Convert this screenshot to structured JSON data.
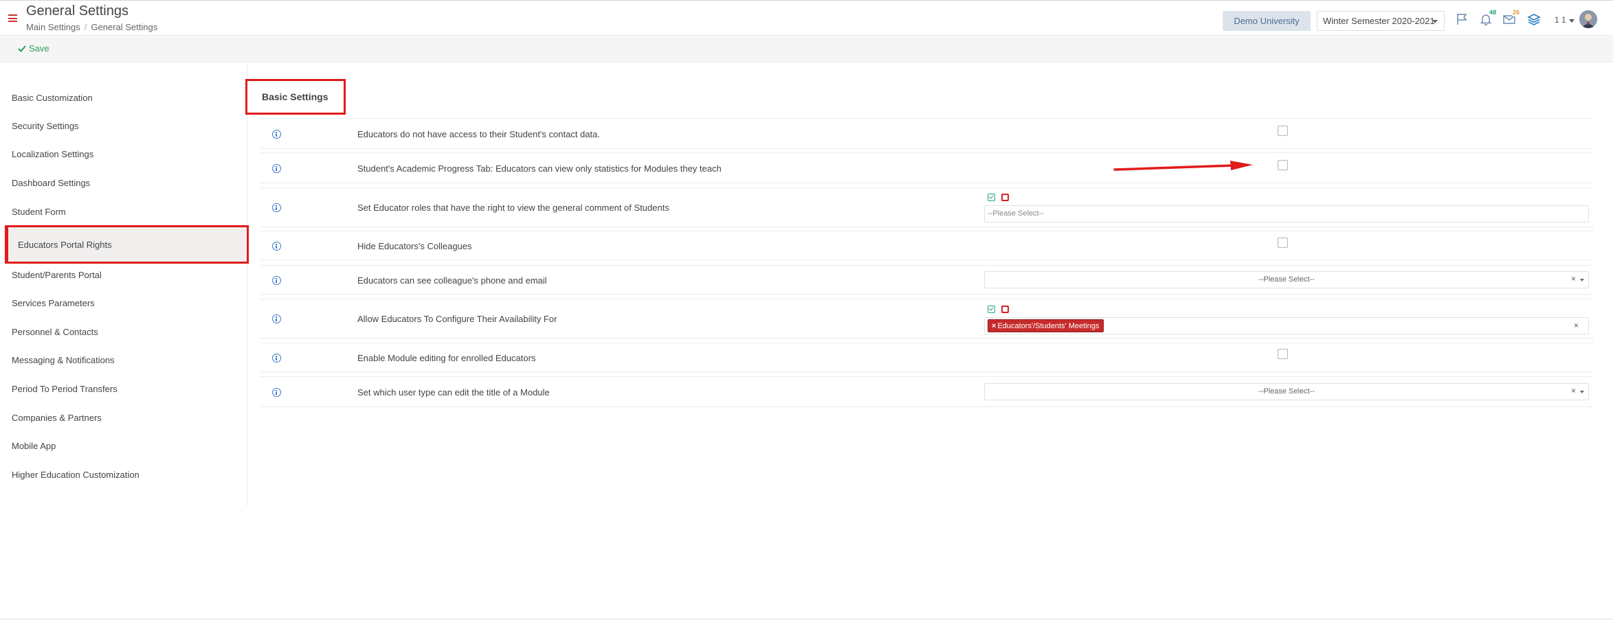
{
  "header": {
    "title": "General Settings",
    "breadcrumb": [
      "Main Settings",
      "General Settings"
    ],
    "university": "Demo University",
    "semester": "Winter Semester 2020-2021",
    "notifications_badge": "48",
    "messages_badge": "26",
    "user_count": "1 1"
  },
  "toolbar": {
    "save_label": "Save"
  },
  "sidebar": {
    "items": [
      "Basic Customization",
      "Security Settings",
      "Localization Settings",
      "Dashboard Settings",
      "Student Form",
      "Educators Portal Rights",
      "Student/Parents Portal",
      "Services Parameters",
      "Personnel & Contacts",
      "Messaging & Notifications",
      "Period To Period Transfers",
      "Companies & Partners",
      "Mobile App",
      "Higher Education Customization"
    ],
    "active": "Educators Portal Rights"
  },
  "section": {
    "title": "Basic Settings"
  },
  "settings": [
    {
      "label": "Educators do not have access to their Student's contact data.",
      "control": "checkbox",
      "checked": false
    },
    {
      "label": "Student's Academic Progress Tab: Educators can view only statistics for Modules they teach",
      "control": "checkbox",
      "checked": false
    },
    {
      "label": "Set Educator roles that have the right to view the general comment of Students",
      "control": "multiselect",
      "placeholder": "--Please Select--"
    },
    {
      "label": "Hide Educators's Colleagues",
      "control": "checkbox",
      "checked": false
    },
    {
      "label": "Educators can see colleague's phone and email",
      "control": "select",
      "placeholder": "--Please Select--"
    },
    {
      "label": "Allow Educators To Configure Their Availability For",
      "control": "multiselect",
      "tag": "Educators'/Students' Meetings"
    },
    {
      "label": "Enable Module editing for enrolled Educators",
      "control": "checkbox",
      "checked": false
    },
    {
      "label": "Set which user type can edit the title of a Module",
      "control": "select",
      "placeholder": "--Please Select--"
    }
  ],
  "colors": {
    "accent_red": "#e11b1b",
    "save_green": "#2e9e5b",
    "info_blue": "#3a78c9",
    "tag_red": "#c62b2b"
  }
}
